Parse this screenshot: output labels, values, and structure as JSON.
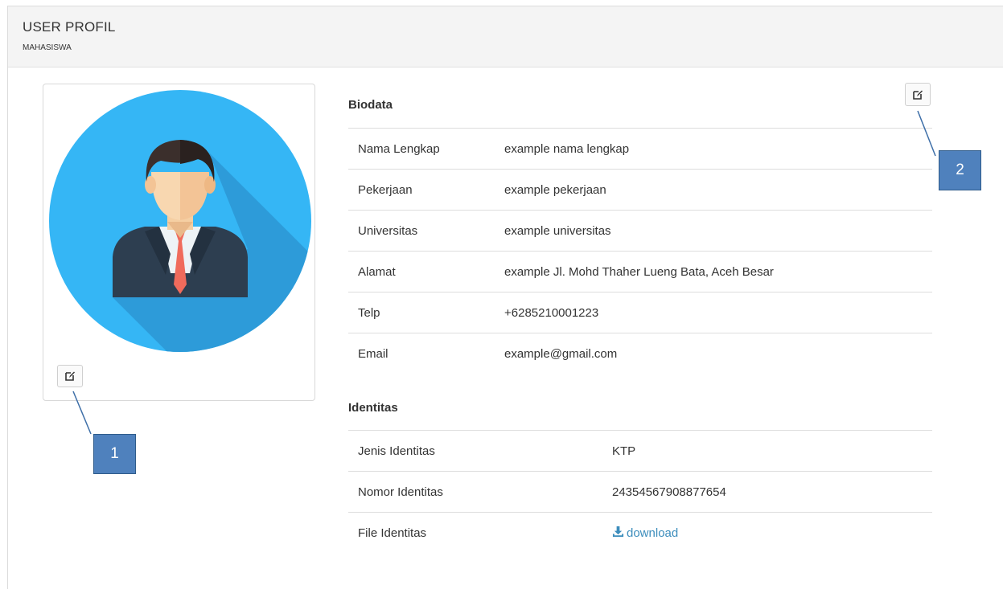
{
  "header": {
    "title": "USER PROFIL",
    "subtitle": "MAHASISWA"
  },
  "biodata": {
    "title": "Biodata",
    "rows": [
      {
        "label": "Nama Lengkap",
        "value": "example nama lengkap"
      },
      {
        "label": "Pekerjaan",
        "value": "example pekerjaan"
      },
      {
        "label": "Universitas",
        "value": "example universitas"
      },
      {
        "label": "Alamat",
        "value": "example Jl. Mohd Thaher Lueng Bata, Aceh Besar"
      },
      {
        "label": "Telp",
        "value": "+6285210001223"
      },
      {
        "label": "Email",
        "value": "example@gmail.com"
      }
    ]
  },
  "identitas": {
    "title": "Identitas",
    "rows": [
      {
        "label": "Jenis Identitas",
        "value": "KTP"
      },
      {
        "label": "Nomor Identitas",
        "value": "24354567908877654"
      },
      {
        "label": "File Identitas",
        "value": "download"
      }
    ]
  },
  "callouts": [
    "1",
    "2"
  ],
  "icons": {
    "edit": "edit-icon",
    "download": "download-icon",
    "avatar": "user-avatar"
  },
  "colors": {
    "accent": "#3c8dbc",
    "callout": "#4f81bd",
    "avatar_bg": "#35b6f5"
  }
}
